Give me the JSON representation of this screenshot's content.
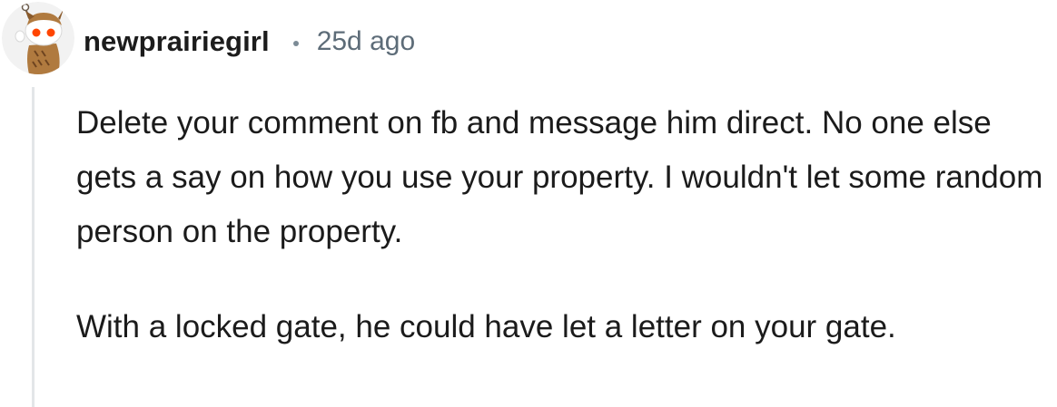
{
  "comment": {
    "author": "newprairiegirl",
    "separator": "•",
    "timestamp": "25d ago",
    "avatar_icon": "snoo-owl-avatar-icon",
    "paragraphs": [
      "Delete your comment on fb and message him direct. No one else gets a say on how you use your property. I wouldn't let some random person on the property.",
      "With a locked gate, he could have let a letter on your gate."
    ]
  },
  "colors": {
    "username": "#1c1c1c",
    "timestamp": "#5d6c78",
    "thread_line": "#e3e6e8",
    "body_text": "#1b1b1b"
  }
}
